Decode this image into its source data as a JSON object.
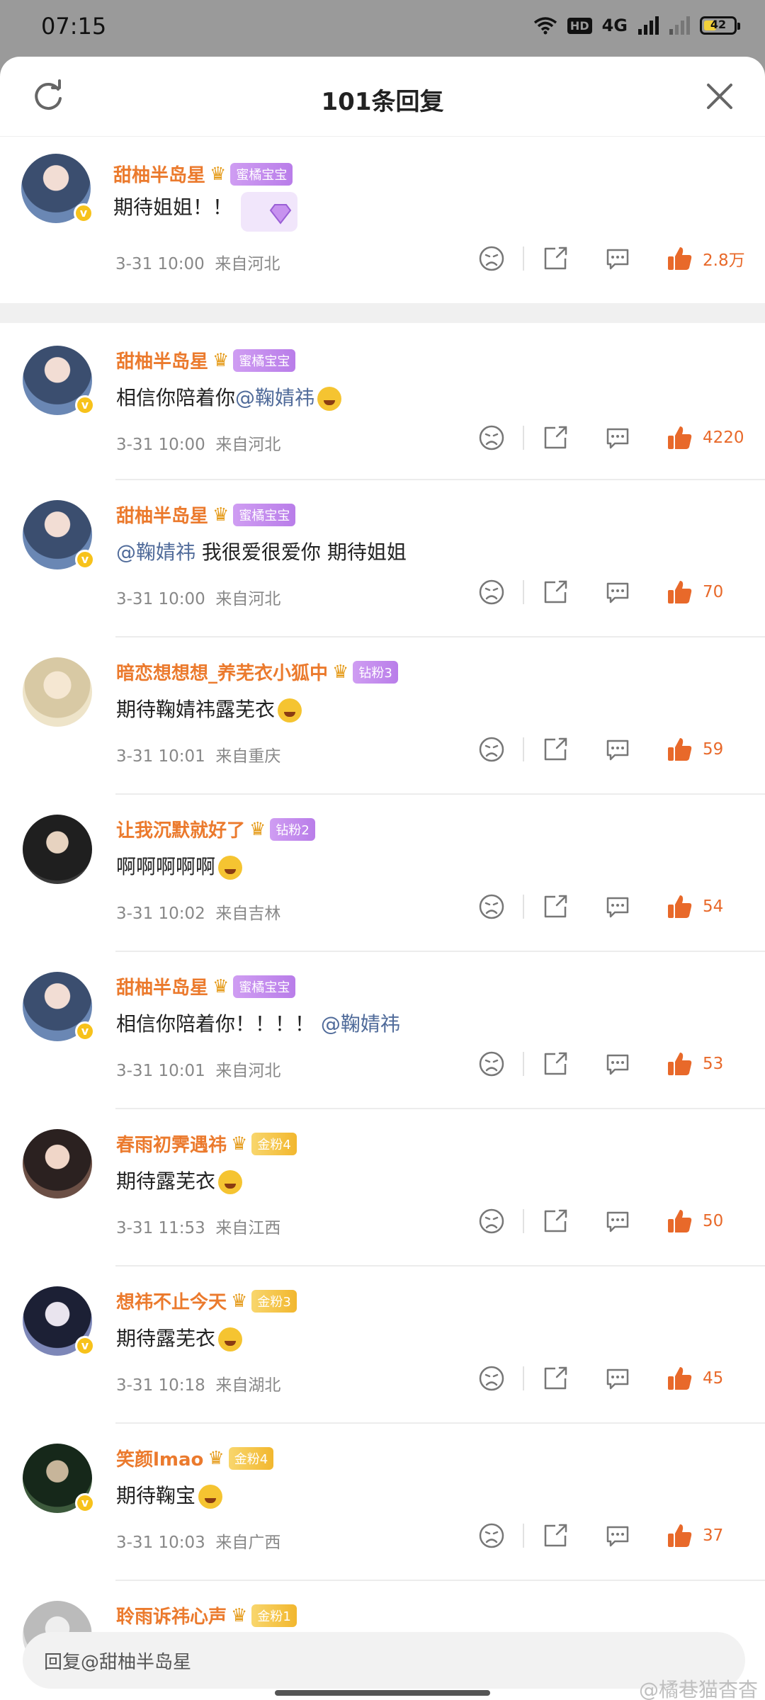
{
  "status_bar": {
    "time": "07:15",
    "network_label": "4G",
    "hd_label": "HD",
    "battery": "42",
    "battery_level": 0.42
  },
  "header": {
    "title": "101条回复"
  },
  "top_comment": {
    "username": "甜柚半岛星",
    "fan_badge": "蜜橘宝宝",
    "text": "期待姐姐！！",
    "time": "3-31  10:00",
    "location": "来自河北",
    "likes": "2.8万"
  },
  "replies": [
    {
      "username": "甜柚半岛星",
      "fan_badge": "蜜橘宝宝",
      "badge_color": "purple",
      "verified": true,
      "text_before": "相信你陪着你",
      "mention": "@鞠婧祎",
      "text_after": "",
      "emoji": true,
      "time": "3-31  10:00",
      "location": "来自河北",
      "likes": "4220"
    },
    {
      "username": "甜柚半岛星",
      "fan_badge": "蜜橘宝宝",
      "badge_color": "purple",
      "verified": true,
      "text_before": "",
      "mention": "@鞠婧祎",
      "text_after": "  我很爱很爱你  期待姐姐",
      "emoji": false,
      "time": "3-31  10:00",
      "location": "来自河北",
      "likes": "70"
    },
    {
      "username": "暗恋想想想_养芜衣小狐中",
      "fan_badge": "钻粉3",
      "badge_color": "purple",
      "verified": false,
      "text_before": "期待鞠婧祎露芜衣",
      "mention": "",
      "text_after": "",
      "emoji": true,
      "time": "3-31  10:01",
      "location": "来自重庆",
      "likes": "59"
    },
    {
      "username": "让我沉默就好了",
      "fan_badge": "钻粉2",
      "badge_color": "purple",
      "verified": false,
      "text_before": "啊啊啊啊啊",
      "mention": "",
      "text_after": "",
      "emoji": true,
      "time": "3-31  10:02",
      "location": "来自吉林",
      "likes": "54"
    },
    {
      "username": "甜柚半岛星",
      "fan_badge": "蜜橘宝宝",
      "badge_color": "purple",
      "verified": true,
      "text_before": "相信你陪着你！！！！ ",
      "mention": "@鞠婧祎",
      "text_after": "",
      "emoji": false,
      "time": "3-31  10:01",
      "location": "来自河北",
      "likes": "53"
    },
    {
      "username": "春雨初霁遇祎",
      "fan_badge": "金粉4",
      "badge_color": "gold",
      "verified": false,
      "text_before": "期待露芜衣",
      "mention": "",
      "text_after": "",
      "emoji": true,
      "time": "3-31  11:53",
      "location": "来自江西",
      "likes": "50"
    },
    {
      "username": "想祎不止今天",
      "fan_badge": "金粉3",
      "badge_color": "gold",
      "verified": true,
      "text_before": "期待露芜衣",
      "mention": "",
      "text_after": "",
      "emoji": true,
      "time": "3-31  10:18",
      "location": "来自湖北",
      "likes": "45"
    },
    {
      "username": "笑颜lmao",
      "fan_badge": "金粉4",
      "badge_color": "gold",
      "verified": true,
      "text_before": "期待鞠宝",
      "mention": "",
      "text_after": "",
      "emoji": true,
      "time": "3-31  10:03",
      "location": "来自广西",
      "likes": "37"
    },
    {
      "username": "聆雨诉祎心声",
      "fan_badge": "金粉1",
      "badge_color": "gold",
      "verified": false,
      "text_before": "",
      "mention": "",
      "text_after": "",
      "emoji": false,
      "time": "",
      "location": "",
      "likes": ""
    }
  ],
  "reply_bar": {
    "placeholder": "回复@甜柚半岛星"
  },
  "watermark": "@橘巷猫杳杳",
  "colors": {
    "username": "#eb7a2d",
    "mention": "#506b9a",
    "like": "#e8692a",
    "badge_purple": "#c58cef",
    "badge_gold": "#f4c03f"
  },
  "icons": [
    "refresh-icon",
    "close-icon",
    "dislike-icon",
    "share-icon",
    "comment-icon",
    "like-icon",
    "crown-icon",
    "verified-icon"
  ]
}
